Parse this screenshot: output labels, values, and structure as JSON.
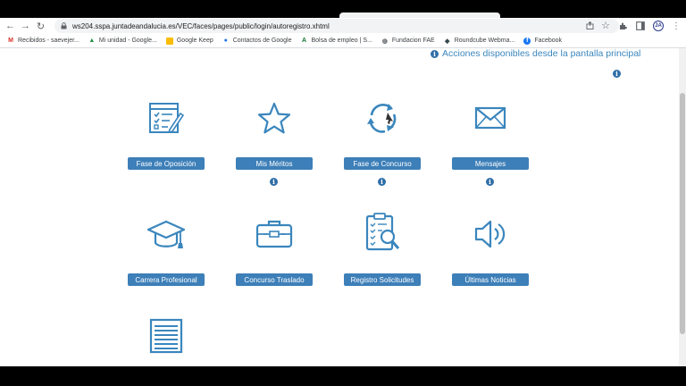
{
  "browser": {
    "url": "ws204.sspa.juntadeandalucia.es/VEC/faces/pages/public/login/autoregistro.xhtml",
    "nav": {
      "back": "←",
      "forward": "→",
      "reload": "↻"
    }
  },
  "bookmarks": [
    {
      "label": "Recibidos - saevejer...",
      "icon": "gmail-icon",
      "glyph": "M",
      "color": "#d93025"
    },
    {
      "label": "Mi unidad - Google...",
      "icon": "google-drive-icon",
      "glyph": "▲",
      "color": "#1e8e3e"
    },
    {
      "label": "Google Keep",
      "icon": "google-keep-icon",
      "glyph": "▪",
      "color": "#fbbc04"
    },
    {
      "label": "Contactos de Google",
      "icon": "google-contacts-icon",
      "glyph": "●",
      "color": "#1a73e8"
    },
    {
      "label": "Bolsa de empleo | S...",
      "icon": "bolsa-empleo-icon",
      "glyph": "A",
      "color": "#137333"
    },
    {
      "label": "Fundacion FAE",
      "icon": "globe-icon",
      "glyph": "◍",
      "color": "#5f6368"
    },
    {
      "label": "Roundcube Webma...",
      "icon": "roundcube-icon",
      "glyph": "◆",
      "color": "#37474f"
    },
    {
      "label": "Facebook",
      "icon": "facebook-icon",
      "glyph": "f",
      "color": "#1877f2"
    }
  ],
  "page": {
    "header": "Acciones disponibles desde la pantalla principal",
    "info_glyph": "i",
    "tiles": [
      {
        "label": "Fase de Oposición",
        "icon": "form-edit-icon",
        "has_info": false
      },
      {
        "label": "Mis Méritos",
        "icon": "star-icon",
        "has_info": true
      },
      {
        "label": "Fase de Concurso",
        "icon": "refresh-cycle-icon",
        "has_info": true
      },
      {
        "label": "Mensajes",
        "icon": "envelope-icon",
        "has_info": true
      },
      {
        "label": "Carrera Profesional",
        "icon": "graduation-cap-icon",
        "has_info": false
      },
      {
        "label": "Concurso Traslado",
        "icon": "briefcase-icon",
        "has_info": false
      },
      {
        "label": "Registro Solicitudes",
        "icon": "clipboard-search-icon",
        "has_info": false
      },
      {
        "label": "Últimas Noticias",
        "icon": "speaker-icon",
        "has_info": false
      },
      {
        "label": "",
        "icon": "document-list-icon",
        "has_info": false
      }
    ]
  },
  "colors": {
    "accent": "#3d7fb8",
    "link": "#3a86bd",
    "icon": "#3a86bd"
  }
}
